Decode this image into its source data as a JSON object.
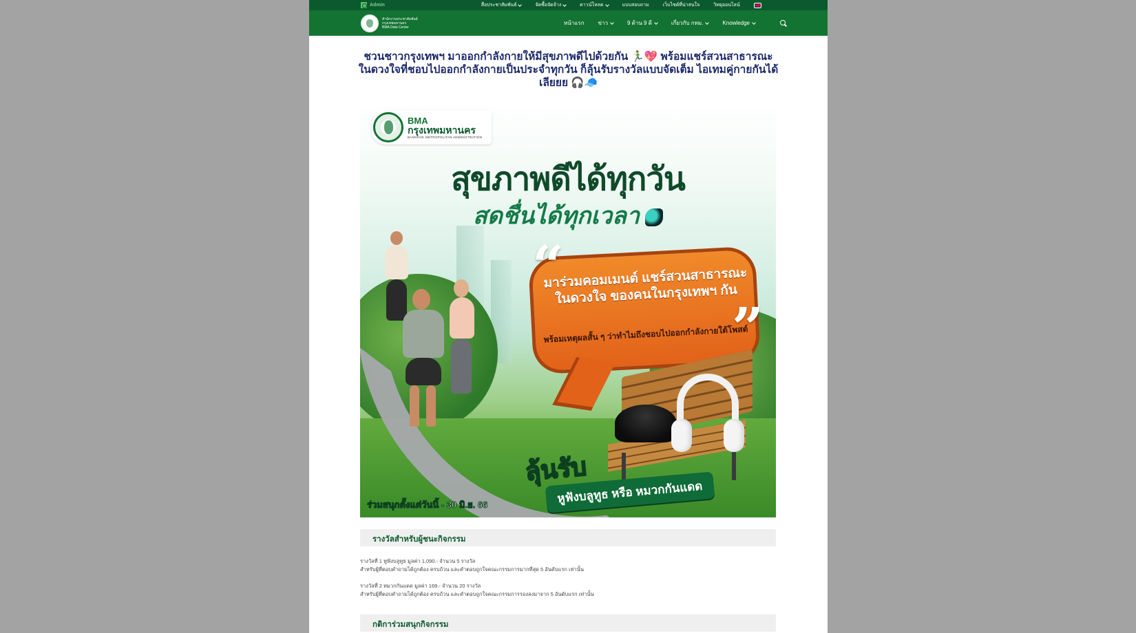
{
  "topbar": {
    "admin_label": "Admin",
    "links": [
      "สื่อประชาสัมพันธ์",
      "จัดซื้อจัดจ้าง",
      "ดาวน์โหลด",
      "แบบสอบถาม",
      "เว็บไซต์ที่น่าสนใจ",
      "วิทยุออนไลน์"
    ],
    "links_with_dropdown": [
      true,
      true,
      true,
      false,
      false,
      false
    ]
  },
  "header": {
    "logo_lines": [
      "สำนักงานประชาสัมพันธ์",
      "กรุงเทพมหานคร",
      "BMA Data Center"
    ],
    "nav": [
      {
        "label": "หน้าแรก",
        "dropdown": false
      },
      {
        "label": "ข่าว",
        "dropdown": true
      },
      {
        "label": "9 ด้าน 9 ดี",
        "dropdown": true
      },
      {
        "label": "เกี่ยวกับ กทม.",
        "dropdown": true
      },
      {
        "label": "Knowledge",
        "dropdown": true
      }
    ]
  },
  "article": {
    "headline": "ชวนชาวกรุงเทพฯ มาออกกำลังกายให้มีสุขภาพดีไปด้วยกัน 🏃‍♂️💖 พร้อมแชร์สวนสาธารณะในดวงใจที่ชอบไปออกกำลังกายเป็นประจำทุกวัน ก็ลุ้นรับรางวัลแบบจัดเต็ม ไอเทมคู่กายกันได้เลียยย 🎧🧢"
  },
  "banner": {
    "logo_bma": "BMA",
    "logo_th": "กรุงเทพมหานคร",
    "logo_en": "BANGKOK METROPOLITAN ADMINISTRATION",
    "title1": "สุขภาพดีได้ทุกวัน",
    "title2": "สดชื่นได้ทุกเวลา",
    "bubble_main": "มาร่วมคอมเมนต์ แชร์สวนสาธารณะในดวงใจ ของคนในกรุงเทพฯ กัน",
    "bubble_sub": "พร้อมเหตุผลสั้น ๆ ว่าทำไมถึงชอบไปออกกำลังกายใต้โพสต์",
    "prize_big": "ลุ้นรับ",
    "prize_items": "หูฟังบลูทูธ หรือ หมวกกันแดด",
    "dates": "ร่วมสนุกตั้งแต่วันนี้ - 30 มิ.ย. 66"
  },
  "rewards": {
    "title": "รางวัลสำหรับผู้ชนะกิจกรรม",
    "prize1_line1": "รางวัลที่ 1 หูฟังบลูทูธ มูลค่า 1,090.- จำนวน 5 รางวัล",
    "prize1_line2": "สำหรับผู้ที่ตอบคำถามได้ถูกต้อง ครบถ้วน และคำตอบถูกใจคณะกรรมการมากที่สุด 5 อันดับแรก เท่านั้น",
    "prize2_line1": "รางวัลที่ 2 หมวกกันแดด มูลค่า 169.- จำนวน 20 รางวัล",
    "prize2_line2": "สำหรับผู้ที่ตอบคำถามได้ถูกต้อง ครบถ้วน และคำตอบถูกใจคณะกรรมการรองลงมาจาก 5 อันดับแรก เท่านั้น"
  },
  "rules": {
    "title": "กติการ่วมสนุกกิจกรรม"
  },
  "colors": {
    "topbar": "#0b5a2d",
    "navbar": "#137332",
    "headline": "#1d2a6b",
    "section_title": "#0b5a2d",
    "bubble": "#e8721f"
  },
  "icons": [
    "admin-icon",
    "search-icon",
    "uk-flag-icon",
    "chevron-down-icon"
  ]
}
